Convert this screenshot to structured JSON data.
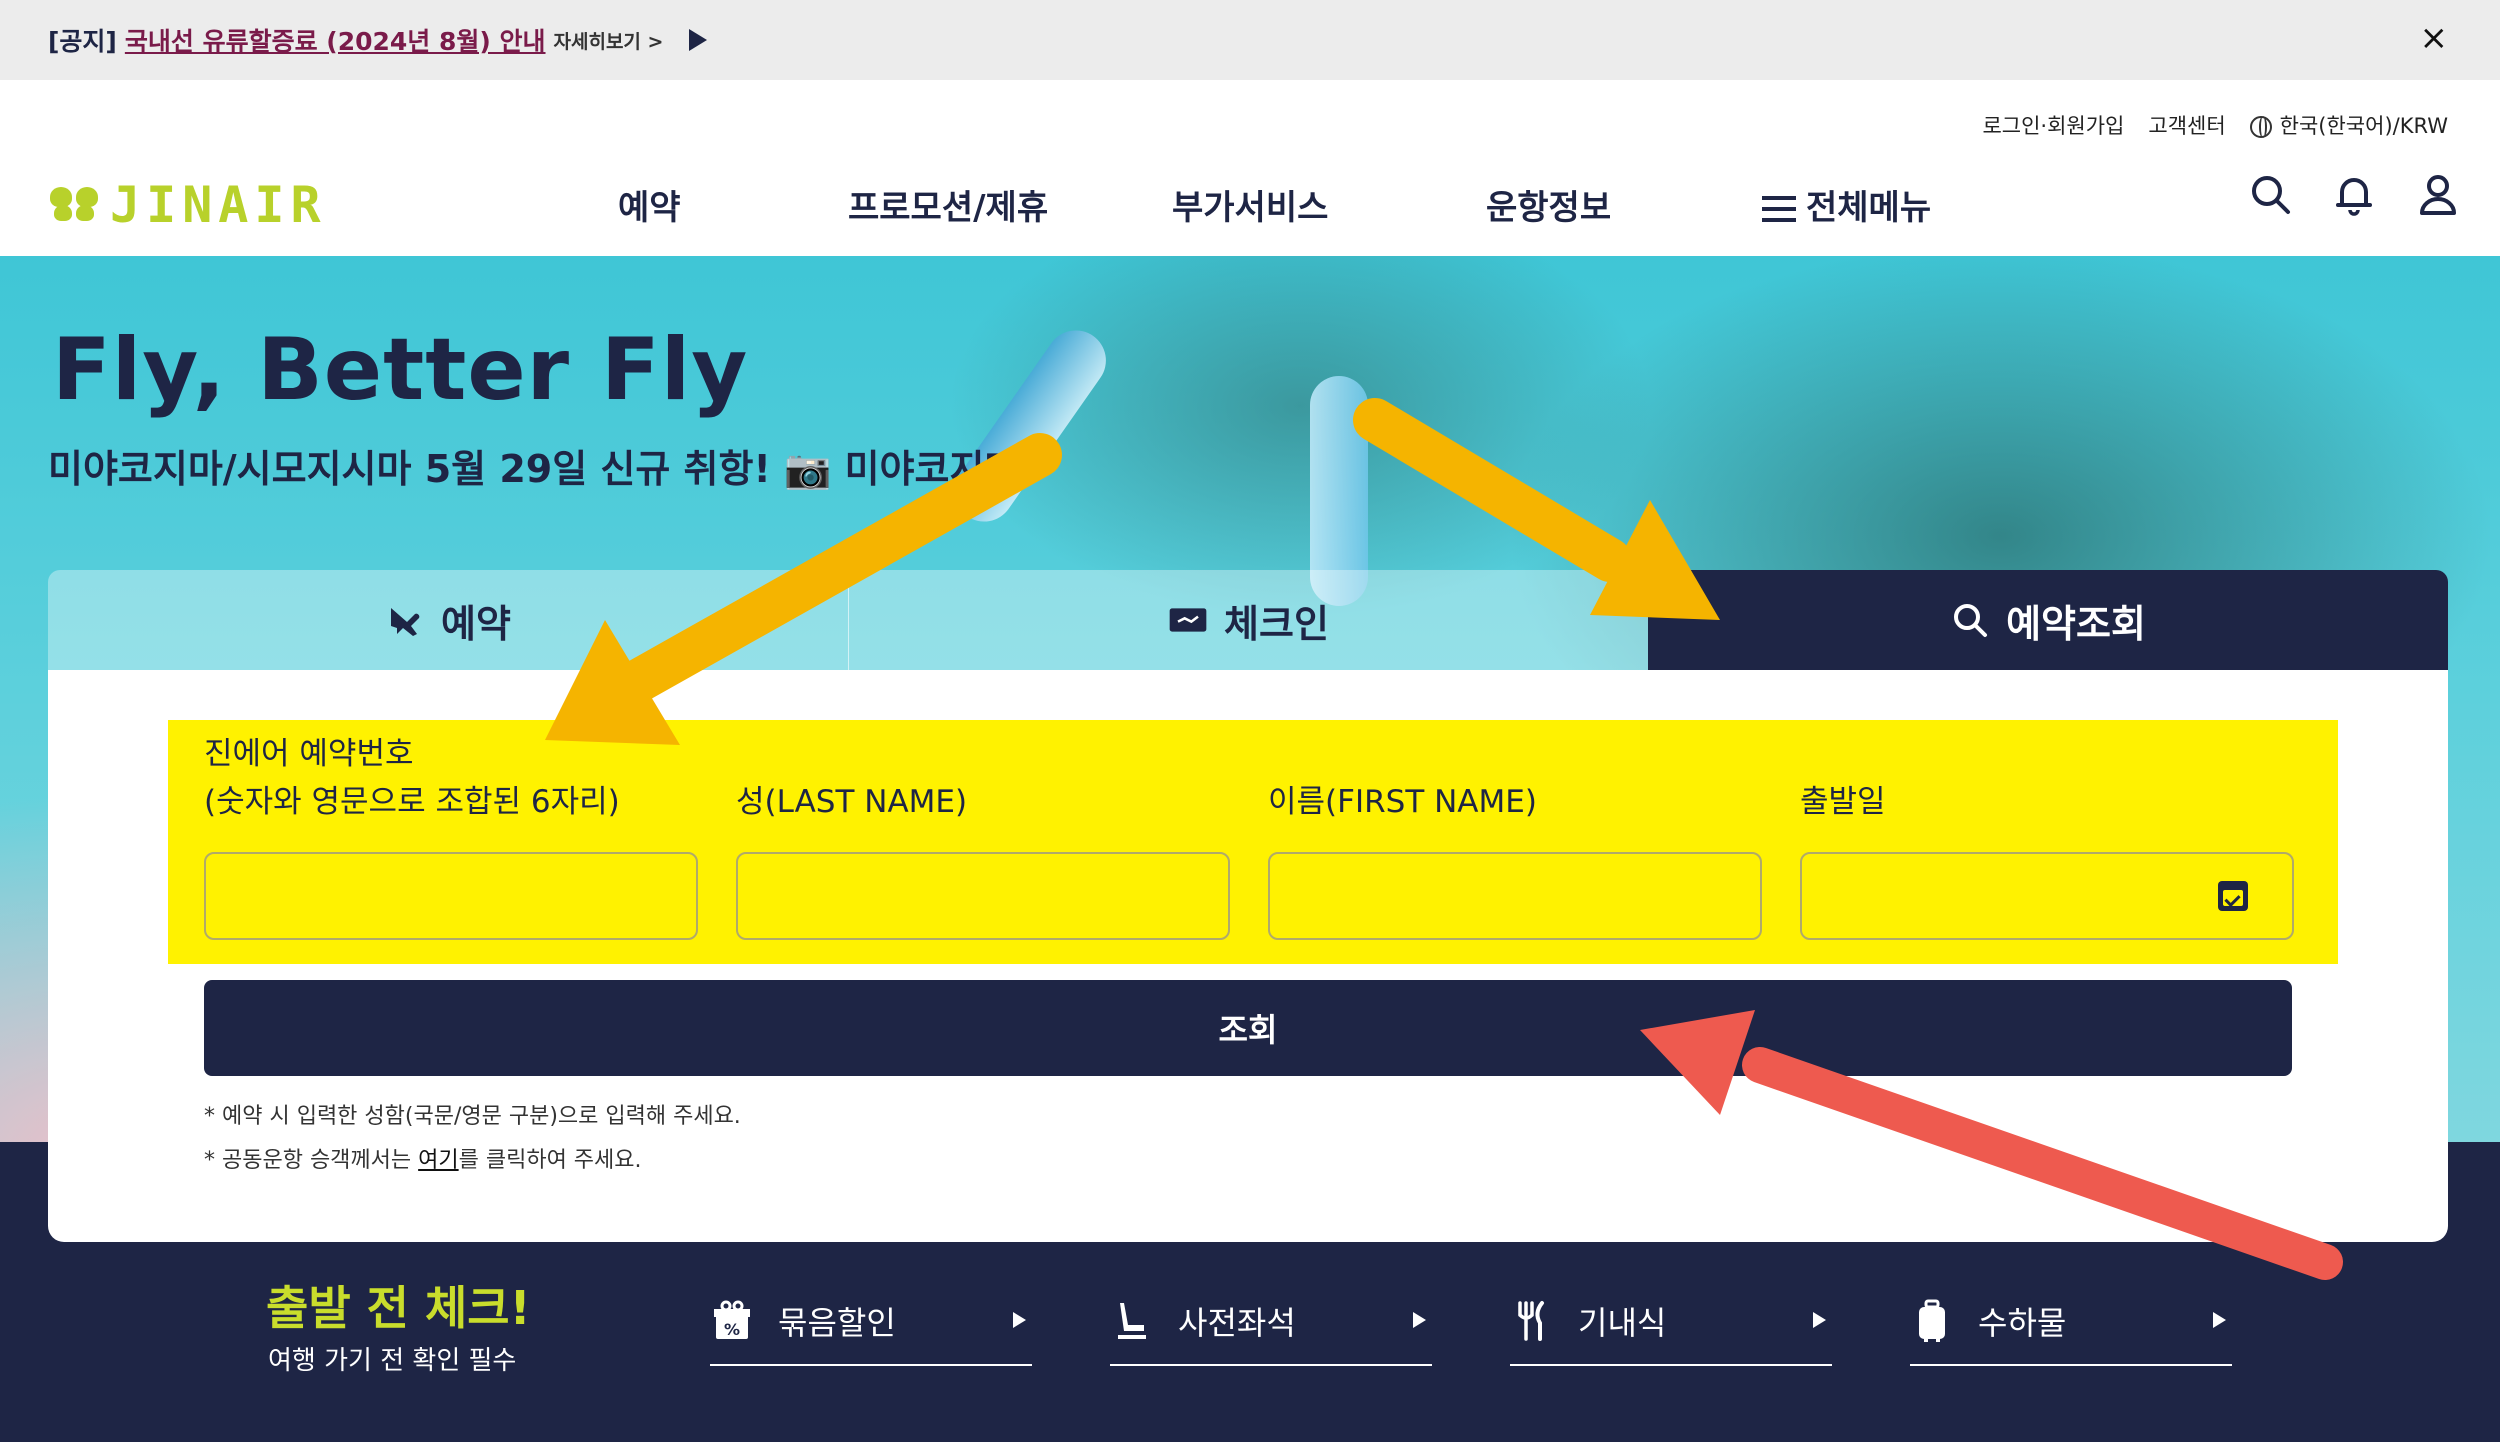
{
  "notice": {
    "tag": "[공지]",
    "message": "국내선 유류할증료 (2024년 8월) 안내",
    "more": "자세히보기 >",
    "close": "×"
  },
  "header": {
    "utility": [
      "로그인·회원가입",
      "고객센터",
      "한국(한국어)/KRW"
    ],
    "logo_text": "JINAIR",
    "nav": [
      "예약",
      "프로모션/제휴",
      "부가서비스",
      "운항정보",
      "전체메뉴"
    ]
  },
  "hero": {
    "title": "Fly, Better Fly",
    "subtitle": "미야코지마/시모지시마 5월 29일 신규 취항! 📷 미야코지마"
  },
  "tabs": [
    "예약",
    "체크인",
    "예약조회"
  ],
  "form": {
    "fields": [
      {
        "label_line1": "진에어 예약번호",
        "label_line2": "(숫자와 영문으로 조합된 6자리)",
        "value": ""
      },
      {
        "label_line1": "",
        "label_line2": "성(LAST NAME)",
        "value": ""
      },
      {
        "label_line1": "",
        "label_line2": "이름(FIRST NAME)",
        "value": ""
      },
      {
        "label_line1": "",
        "label_line2": "출발일",
        "value": ""
      }
    ],
    "submit_label": "조회",
    "note1": "* 예약 시 입력한 성함(국문/영문 구분)으로 입력해 주세요.",
    "note2_pre": "* 공동운항 승객께서는 ",
    "note2_link": "여기",
    "note2_post": "를 클릭하여 주세요."
  },
  "precheck": {
    "title": "출발 전 체크!",
    "subtitle": "여행 가기 전 확인 필수",
    "items": [
      "묶음할인",
      "사전좌석",
      "기내식",
      "수하물"
    ]
  },
  "colors": {
    "navy": "#1e2545",
    "highlight": "#fff200",
    "brand_lime": "#b8d12b",
    "annotation_orange": "#f5b400",
    "annotation_red": "#ee5a4f"
  }
}
